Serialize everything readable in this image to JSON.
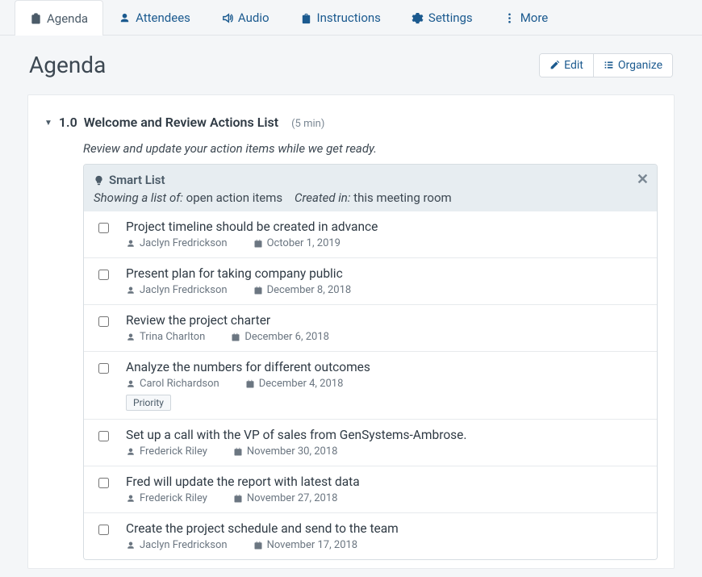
{
  "tabs": [
    {
      "label": "Agenda",
      "icon": "clipboard"
    },
    {
      "label": "Attendees",
      "icon": "user"
    },
    {
      "label": "Audio",
      "icon": "audio"
    },
    {
      "label": "Instructions",
      "icon": "clipboard"
    },
    {
      "label": "Settings",
      "icon": "gear"
    },
    {
      "label": "More",
      "icon": "dots"
    }
  ],
  "page": {
    "title": "Agenda"
  },
  "actions": {
    "edit": "Edit",
    "organize": "Organize"
  },
  "agenda_item": {
    "number": "1.0",
    "title": "Welcome and Review Actions List",
    "duration": "(5 min)",
    "description": "Review and update your action items while we get ready."
  },
  "smart_list": {
    "title": "Smart List",
    "showing_label": "Showing a list of:",
    "showing_value": "open action items",
    "created_label": "Created in:",
    "created_value": "this meeting room"
  },
  "items": [
    {
      "title": "Project timeline should be created in advance",
      "assignee": "Jaclyn Fredrickson",
      "date": "October 1, 2019",
      "tag": null
    },
    {
      "title": "Present plan for taking company public",
      "assignee": "Jaclyn Fredrickson",
      "date": "December 8, 2018",
      "tag": null
    },
    {
      "title": "Review the project charter",
      "assignee": "Trina Charlton",
      "date": "December 6, 2018",
      "tag": null
    },
    {
      "title": "Analyze the numbers for different outcomes",
      "assignee": "Carol Richardson",
      "date": "December 4, 2018",
      "tag": "Priority"
    },
    {
      "title": "Set up a call with the VP of sales from GenSystems-Ambrose.",
      "assignee": "Frederick Riley",
      "date": "November 30, 2018",
      "tag": null
    },
    {
      "title": "Fred will update the report with latest data",
      "assignee": "Frederick Riley",
      "date": "November 27, 2018",
      "tag": null
    },
    {
      "title": "Create the project schedule and send to the team",
      "assignee": "Jaclyn Fredrickson",
      "date": "November 17, 2018",
      "tag": null
    }
  ]
}
